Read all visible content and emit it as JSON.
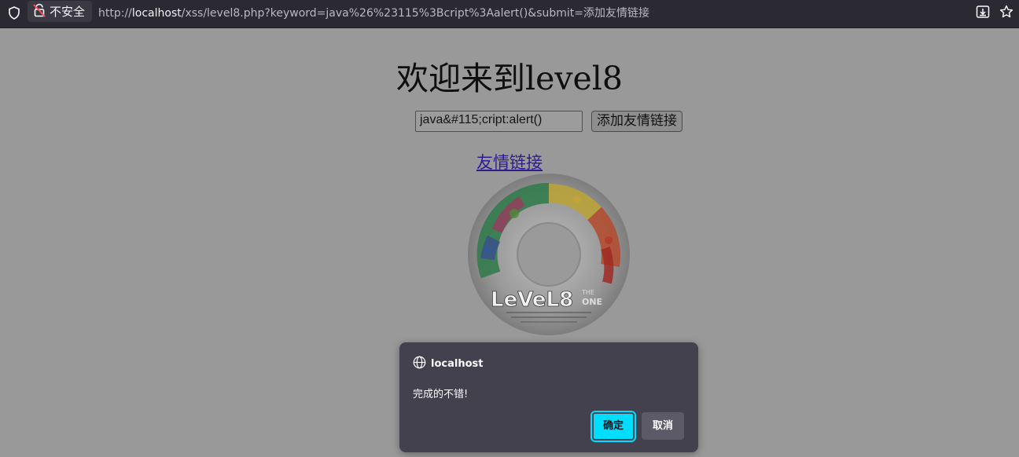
{
  "browser": {
    "security_label": "不安全",
    "url_prefix": "http://",
    "url_host": "localhost",
    "url_rest": "/xss/level8.php?keyword=java%26%23115%3Bcript%3Aalert()&submit=添加友情链接",
    "icons": [
      "shield-icon",
      "insecure-lock-icon",
      "download-icon",
      "bookmark-star-icon"
    ]
  },
  "page": {
    "title": "欢迎来到level8",
    "keyword_value": "java&#115;cript:alert()",
    "submit_label": "添加友情链接",
    "friend_link_label": "友情链接",
    "disc_image_text": "LeVeL8"
  },
  "dialog": {
    "host": "localhost",
    "message": "完成的不错!",
    "ok_label": "确定",
    "cancel_label": "取消"
  },
  "colors": {
    "chrome_bg": "#2b2a33",
    "page_bg_dimmed": "#999999",
    "dialog_bg": "#42414d",
    "accent": "#00ddff",
    "link": "#2d1c8f"
  }
}
